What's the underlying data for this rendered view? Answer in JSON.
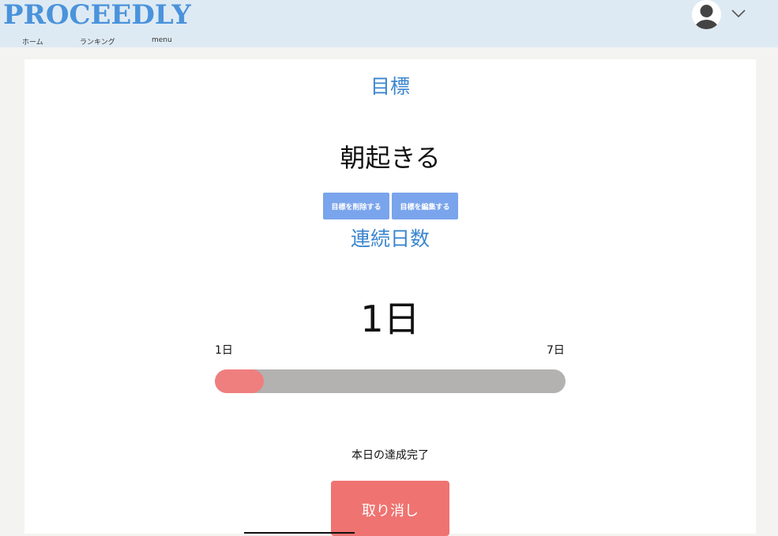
{
  "header": {
    "logo": "PROCEEDLY",
    "nav": [
      "ホーム",
      "ランキング",
      "menu"
    ]
  },
  "goal": {
    "section_title": "目標",
    "text": "朝起きる",
    "delete_label": "目標を削除する",
    "edit_label": "目標を編集する"
  },
  "streak": {
    "section_title": "連続日数",
    "days": "1日",
    "min_label": "1日",
    "max_label": "7日",
    "progress_fraction": 0.14
  },
  "status": {
    "text": "本日の達成完了",
    "cancel_label": "取り消し"
  },
  "colors": {
    "accent": "#3a86cf",
    "button": "#7aa4ec",
    "progress": "#ef7f7f",
    "cancel": "#ef7371"
  }
}
